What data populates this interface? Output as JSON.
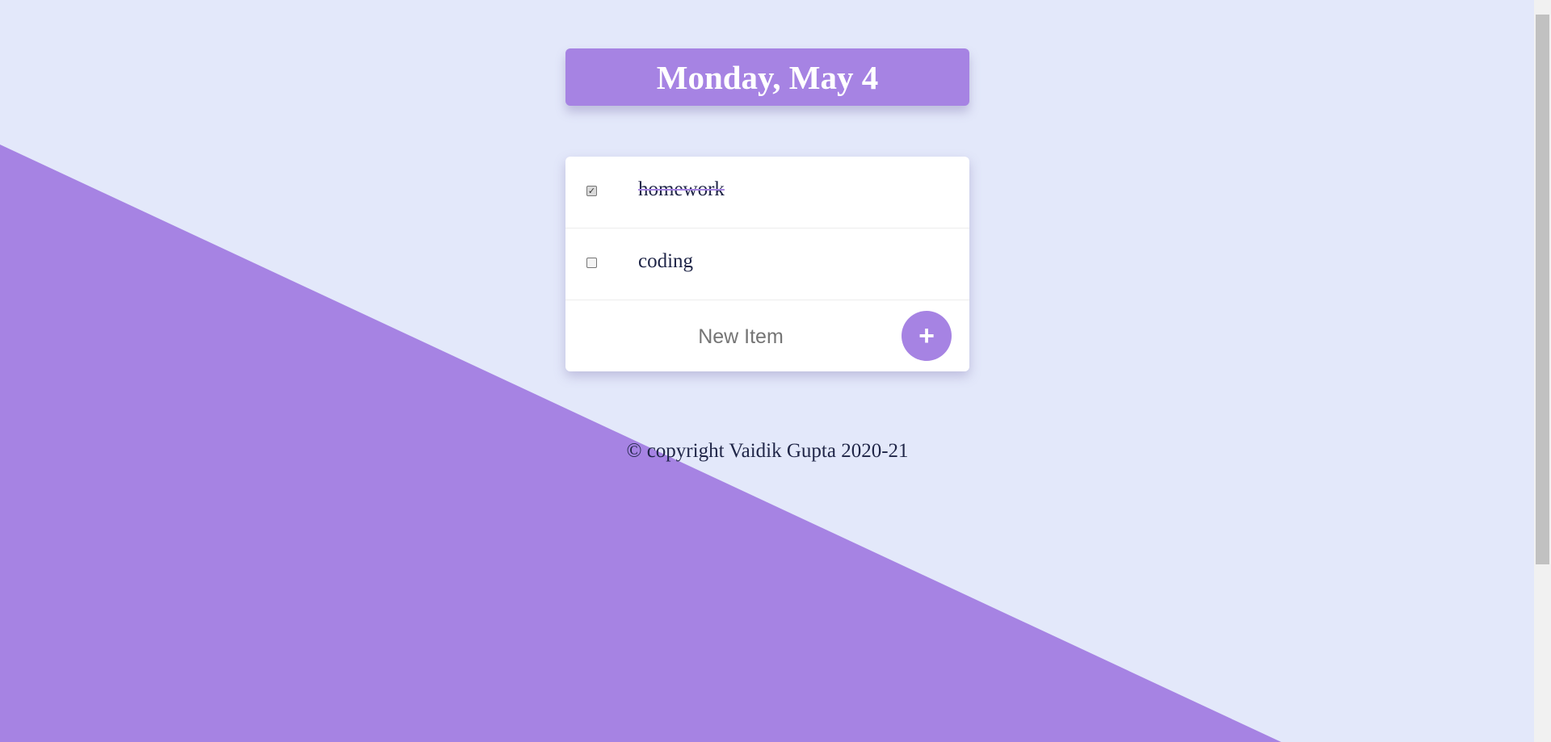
{
  "colors": {
    "background": "#E3E8FA",
    "accent": "#A683E3",
    "text": "#1F2547",
    "placeholder": "#757575"
  },
  "header": {
    "title": "Monday, May 4"
  },
  "todo": {
    "items": [
      {
        "label": "homework",
        "checked": true
      },
      {
        "label": "coding",
        "checked": false
      }
    ],
    "new_item": {
      "placeholder": "New Item",
      "value": ""
    },
    "add_button_label": "+"
  },
  "footer": {
    "text": "© copyright Vaidik Gupta 2020-21"
  }
}
